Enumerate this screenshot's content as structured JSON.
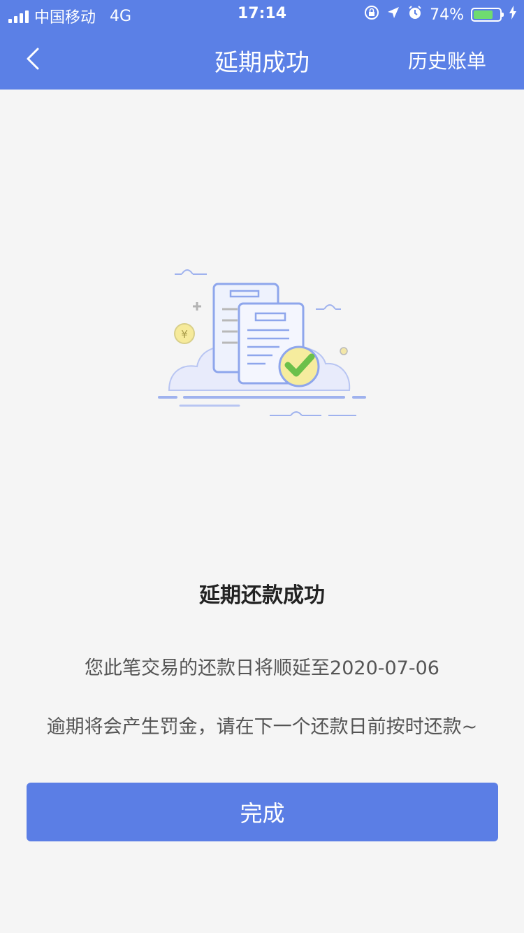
{
  "status_bar": {
    "carrier": "中国移动",
    "network": "4G",
    "time": "17:14",
    "battery_percent": "74%",
    "battery_level": 0.74
  },
  "nav": {
    "title": "延期成功",
    "right_action": "历史账单",
    "back_icon": "chevron-left-icon"
  },
  "colors": {
    "primary": "#5b80e6",
    "background": "#f5f5f5",
    "check_green": "#6cc04a"
  },
  "result": {
    "title": "延期还款成功",
    "message_line1": "您此笔交易的还款日将顺延至2020-07-06",
    "message_line2": "逾期将会产生罚金，请在下一个还款日前按时还款~"
  },
  "button": {
    "label": "完成"
  }
}
